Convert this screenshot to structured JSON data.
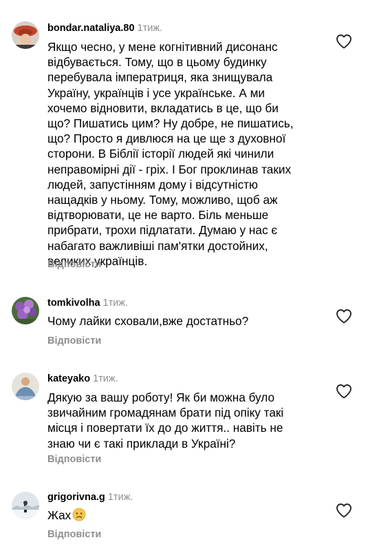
{
  "comments": [
    {
      "username": "bondar.nataliya.80",
      "time": "1тиж.",
      "text": "Якщо чесно, у мене когнітивний дисонанс\nвідбувається. Тому, що в цьому будинку\nперебувала імператриця, яка знищувала\nУкраїну, українців і усе українське. А ми\nхочемо відновити, вкладатись в це, що би\nщо? Пишатись цим? Ну добре, не пишатись,\nщо? Просто я дивлюся на це ще з духовної\nсторони. В Біблії історії людей які чинили\nнеправомірні дії - гріх. І Бог проклинав таких\nлюдей, запустінням дому і відсутністю\nнащадків у ньому. Тому, можливо, щоб аж\nвідтворювати, це не варто. Біль меньше\nприбрати, трохи підлатати. Думаю у нас є\nнабагато важливіші пам'ятки достойних,\nвеликих українців.",
      "reply_label": "Відповісти"
    },
    {
      "username": "tomkivolha",
      "time": "1тиж.",
      "text": "Чому лайки сховали,вже достатньо?",
      "reply_label": "Відповісти"
    },
    {
      "username": "kateyako",
      "time": "1тиж.",
      "text": "Дякую за вашу роботу! Як би можна було\nзвичайним громадянам брати під опіку такі\nмісця і повертати їх до до життя.. навіть не\nзнаю чи є такі приклади в Україні?",
      "reply_label": "Відповісти"
    },
    {
      "username": "grigorivna.g",
      "time": "1тиж.",
      "text": "Жах",
      "emoji": "😢",
      "reply_label": "Відповісти"
    }
  ],
  "colors": {
    "meta_gray": "#8e8e8e",
    "text": "#000000",
    "background": "#ffffff"
  },
  "icons": {
    "like": "heart-outline-icon"
  }
}
